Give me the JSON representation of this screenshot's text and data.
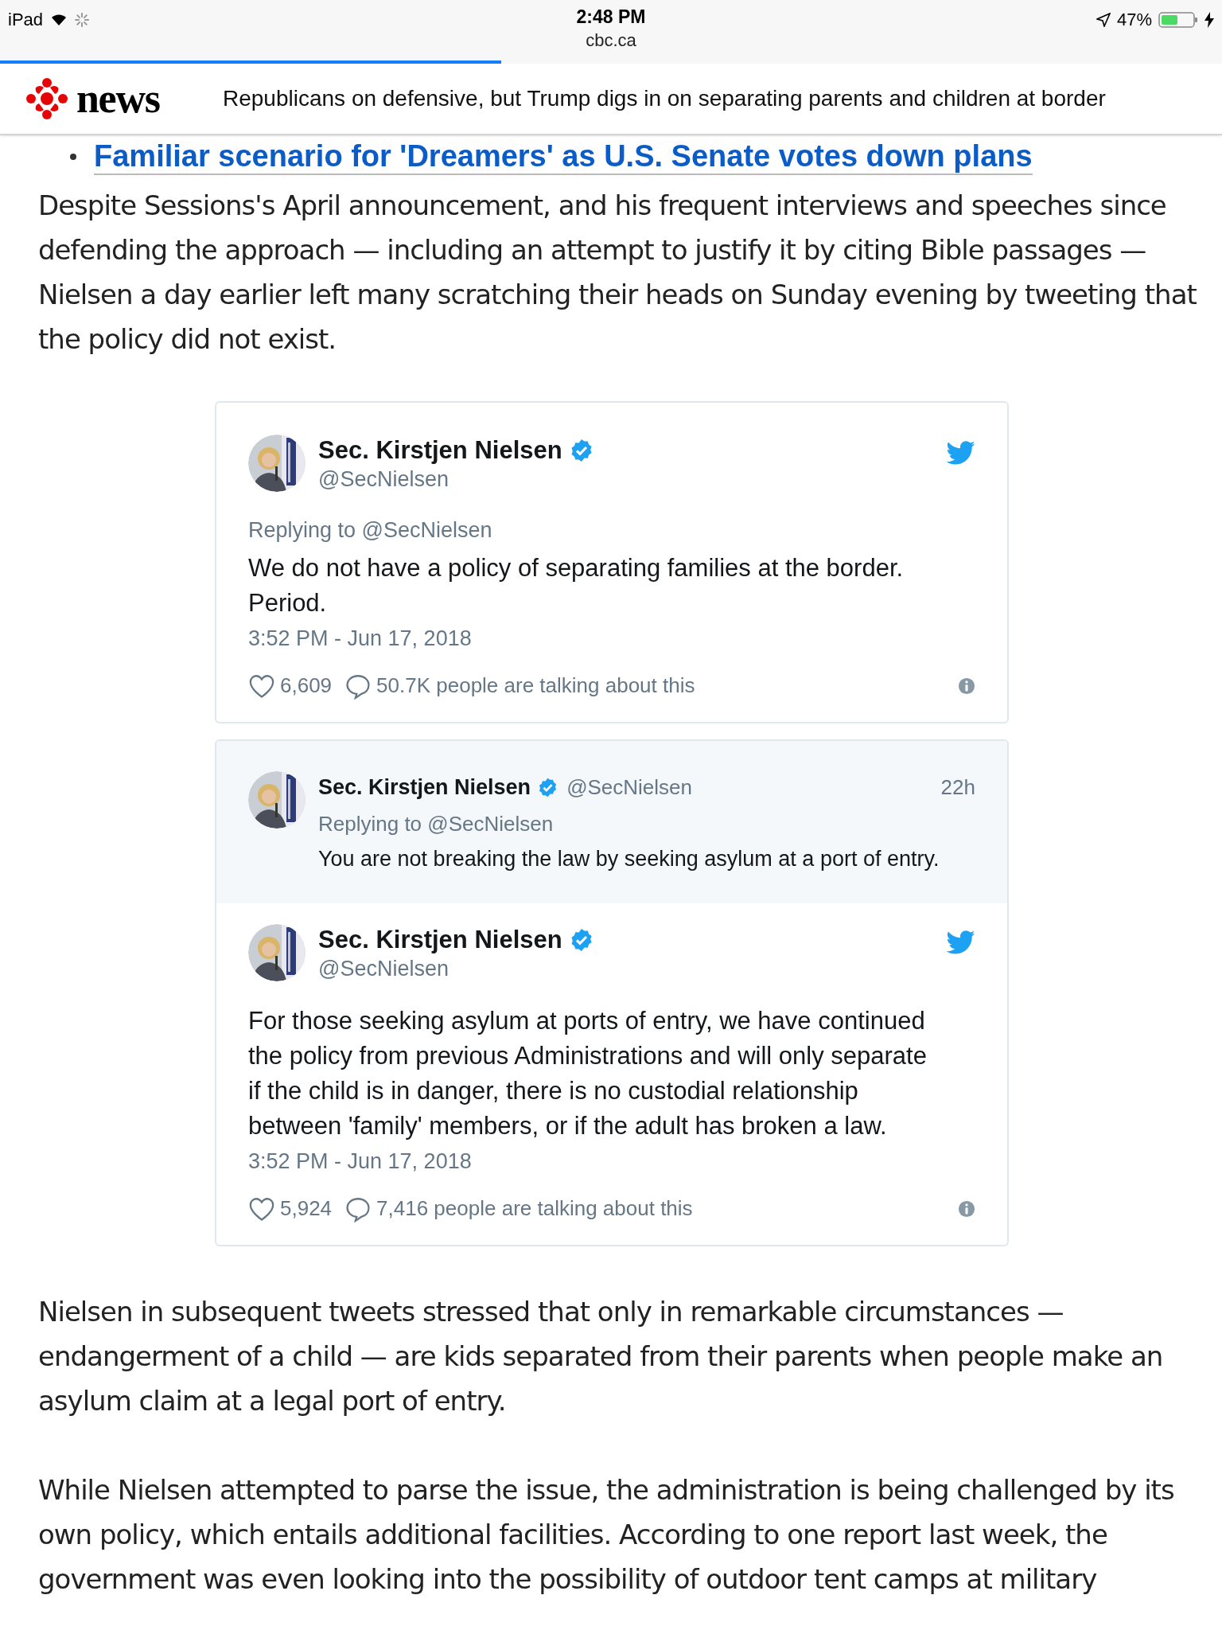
{
  "status_bar": {
    "device": "iPad",
    "time": "2:48 PM",
    "battery": "47%"
  },
  "address": {
    "domain": "cbc.ca"
  },
  "progress": {
    "level": 0.41
  },
  "header": {
    "logo_text": "news",
    "headline": "Republicans on defensive, but Trump digs in on separating parents and children at border"
  },
  "related_link": "Familiar scenario for 'Dreamers' as U.S. Senate votes down plans",
  "paragraphs_top": [
    "Despite Sessions's April announcement, and his frequent interviews and speeches since defending the approach — including an attempt to justify it by citing Bible passages — Nielsen a day earlier left many scratching their heads on Sunday evening by tweeting that the policy did not exist."
  ],
  "embeds": [
    {
      "name": "Sec. Kirstjen Nielsen",
      "handle": "@SecNielsen",
      "replying_to": "Replying to @SecNielsen",
      "text": "We do not have a policy of separating families at the border. Period.",
      "time": "3:52 PM - Jun 17, 2018",
      "likes": "6,609",
      "talking": "50.7K people are talking about this"
    },
    {
      "parent": {
        "name": "Sec. Kirstjen Nielsen",
        "handle": "@SecNielsen",
        "age": "22h",
        "replying_to": "Replying to @SecNielsen",
        "text": "You are not breaking the law by seeking asylum at a port of entry."
      },
      "name": "Sec. Kirstjen Nielsen",
      "handle": "@SecNielsen",
      "text": "For those seeking asylum at ports of entry, we have continued the policy from previous Administrations and will only separate if the child is in danger, there is no custodial relationship between 'family' members, or if the adult has broken a law.",
      "time": "3:52 PM - Jun 17, 2018",
      "likes": "5,924",
      "talking": "7,416 people are talking about this"
    }
  ],
  "paragraphs_bottom": [
    "Nielsen in subsequent tweets stressed that only in remarkable circumstances — endangerment of a child — are kids separated from their parents when people make an asylum claim at a legal port of entry.",
    "While Nielsen attempted to parse the issue, the administration is being challenged by its own policy, which entails additional facilities. According to one report last week, the government was even looking into the possibility of outdoor tent camps at military"
  ]
}
